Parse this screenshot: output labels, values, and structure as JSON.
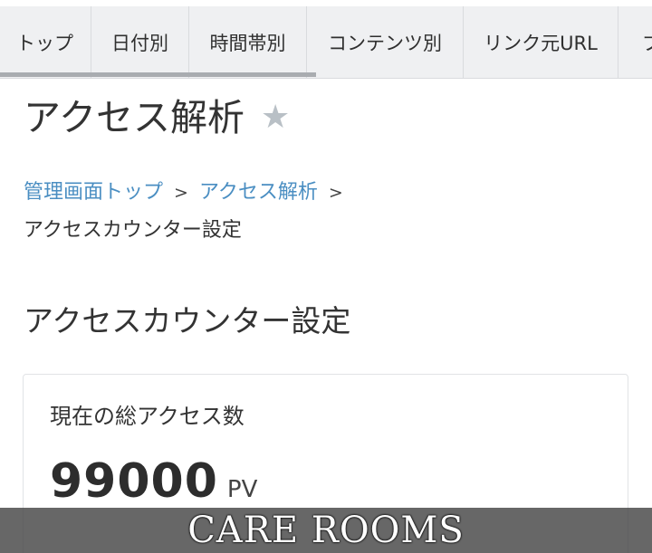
{
  "tabs": [
    {
      "label": "トップ"
    },
    {
      "label": "日付別"
    },
    {
      "label": "時間帯別"
    },
    {
      "label": "コンテンツ別"
    },
    {
      "label": "リンク元URL"
    },
    {
      "label": "ブ"
    }
  ],
  "page": {
    "title": "アクセス解析",
    "favorite_icon": "star-icon"
  },
  "breadcrumb": {
    "items": [
      {
        "label": "管理画面トップ"
      },
      {
        "label": "アクセス解析"
      }
    ],
    "separator": ">",
    "current": "アクセスカウンター設定"
  },
  "section": {
    "title": "アクセスカウンター設定"
  },
  "counter": {
    "label": "現在の総アクセス数",
    "value": "99000",
    "unit": "PV"
  },
  "watermark": {
    "text": "CARE ROOMS"
  },
  "colors": {
    "link": "#4a8ec2",
    "tabbar_bg": "#eff0f2",
    "star": "#b9c0c6",
    "watermark_bg": "#464646"
  }
}
